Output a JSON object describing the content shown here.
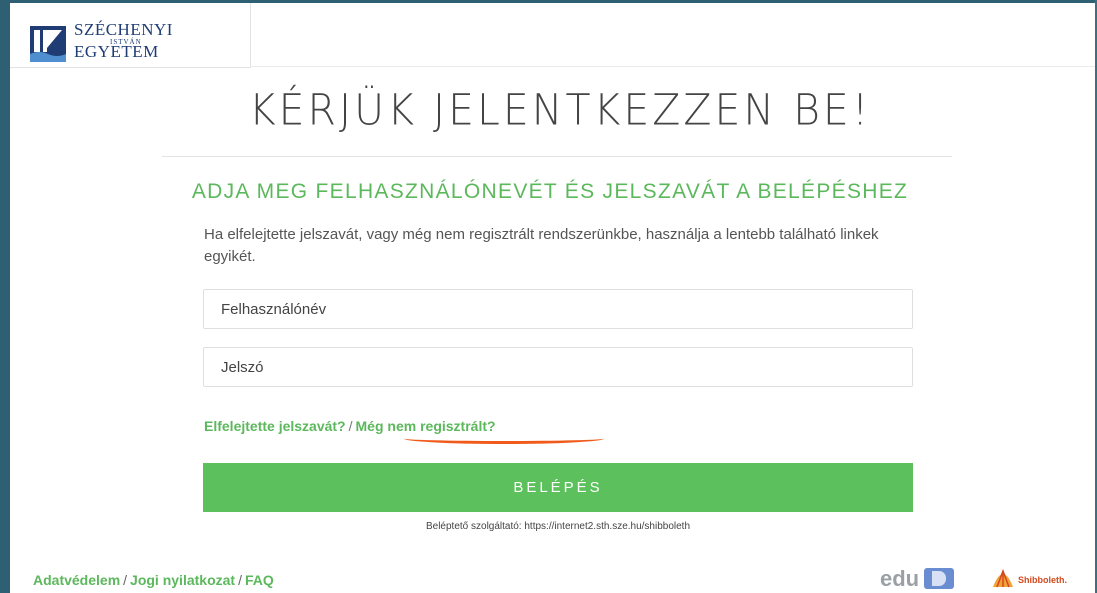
{
  "logo": {
    "line1": "SZÉCHENYI",
    "line_small": "ISTVÁN",
    "line2": "EGYETEM"
  },
  "title": "KÉRJÜK JELENTKEZZEN BE!",
  "subtitle": "ADJA MEG FELHASZNÁLÓNEVÉT ÉS JELSZAVÁT A BELÉPÉSHEZ",
  "help_text": "Ha elfelejtette jelszavát, vagy még nem regisztrált rendszerünkbe, használja a lentebb található linkek egyikét.",
  "form": {
    "username_placeholder": "Felhasználónév",
    "password_placeholder": "Jelszó",
    "forgot_link": "Elfelejtette jelszavát?",
    "separator": "/",
    "register_link": "Még nem regisztrált?",
    "login_button": "BELÉPÉS"
  },
  "provider_text": "Beléptető szolgáltató: https://internet2.sth.sze.hu/shibboleth",
  "footer": {
    "privacy": "Adatvédelem",
    "legal": "Jogi nyilatkozat",
    "faq": "FAQ",
    "separator": "/",
    "eduid_label": "edu",
    "shibboleth_label": "Shibboleth."
  },
  "colors": {
    "accent": "#5cb85c",
    "button": "#5cc15c",
    "frame": "#2f5f73",
    "underline": "#f05a1a"
  }
}
